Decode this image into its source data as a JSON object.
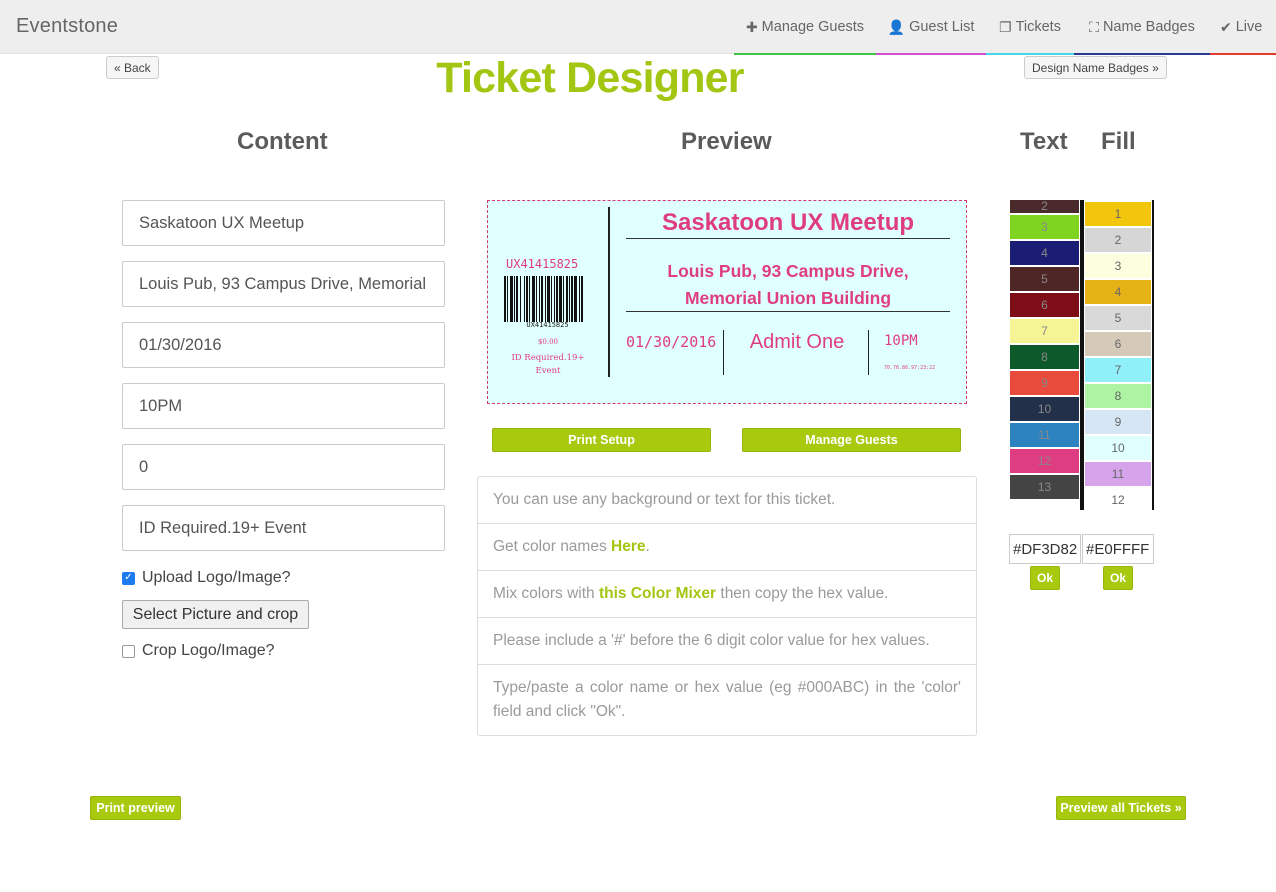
{
  "app": {
    "brand": "Eventstone"
  },
  "nav": [
    {
      "label": "Manage Guests",
      "icon": "plus-icon",
      "glyph": "✚",
      "color": "#44c344"
    },
    {
      "label": "Guest List",
      "icon": "user-icon",
      "glyph": "👤",
      "color": "#d44fcf"
    },
    {
      "label": "Tickets",
      "icon": "copy-icon",
      "glyph": "❐",
      "color": "#46d7e6"
    },
    {
      "label": "Name Badges",
      "icon": "badge-icon",
      "glyph": "⛶",
      "color": "#2a3b8f"
    },
    {
      "label": "Live",
      "icon": "check-icon",
      "glyph": "✔",
      "color": "#e23b2f"
    }
  ],
  "header": {
    "back_label": "« Back",
    "title": "Ticket Designer",
    "design_badges_label": "Design Name Badges »"
  },
  "columns": {
    "content": "Content",
    "preview": "Preview",
    "text": "Text",
    "fill": "Fill"
  },
  "fields": {
    "event_name": "Saskatoon UX Meetup",
    "venue": "Louis Pub, 93 Campus Drive, Memorial",
    "date": "01/30/2016",
    "time": "10PM",
    "price": "0",
    "notes": "ID Required.19+ Event"
  },
  "options": {
    "upload_logo_label": "Upload Logo/Image?",
    "upload_logo_checked": true,
    "select_picture_label": "Select Picture and crop",
    "crop_logo_label": "Crop Logo/Image?",
    "crop_logo_checked": false
  },
  "ticket": {
    "code": "UX41415825",
    "barcode_number": "UX41415825",
    "price": "$0.00",
    "note_line1": "ID Required.19+",
    "note_line2": "Event",
    "title": "Saskatoon UX Meetup",
    "venue_line1": "Louis Pub, 93 Campus Drive,",
    "venue_line2": "Memorial Union Building",
    "date": "01/30/2016",
    "admit": "Admit One",
    "time": "10PM",
    "ip": "70.76.86.97:23:22",
    "text_color": "#DF3D82",
    "fill_color": "#E0FFFF"
  },
  "preview_buttons": {
    "print_setup": "Print Setup",
    "manage_guests": "Manage Guests"
  },
  "info": {
    "item1": "You can use any background or text for this ticket.",
    "item2_pre": "Get color names ",
    "item2_link": "Here",
    "item2_post": ".",
    "item3_pre": "Mix colors with ",
    "item3_link": "this Color Mixer",
    "item3_post": " then copy the hex value.",
    "item4": "Please include a '#' before the 6 digit color value for hex values.",
    "item5": "Type/paste a color name or hex value (eg #000ABC) in the 'color' field and click \"Ok\"."
  },
  "text_palette": [
    {
      "n": "2",
      "c": "#4a2a2a"
    },
    {
      "n": "3",
      "c": "#7fd321"
    },
    {
      "n": "4",
      "c": "#1a1d73"
    },
    {
      "n": "5",
      "c": "#4e2626"
    },
    {
      "n": "6",
      "c": "#7d0d16"
    },
    {
      "n": "7",
      "c": "#f5f596"
    },
    {
      "n": "8",
      "c": "#0c5a2a"
    },
    {
      "n": "9",
      "c": "#e84a3c"
    },
    {
      "n": "10",
      "c": "#23304a"
    },
    {
      "n": "11",
      "c": "#2d82c0"
    },
    {
      "n": "12",
      "c": "#df3d82"
    },
    {
      "n": "13",
      "c": "#444444"
    }
  ],
  "fill_palette": [
    {
      "n": "1",
      "c": "#f2c60c"
    },
    {
      "n": "2",
      "c": "#d6d6d6"
    },
    {
      "n": "3",
      "c": "#fdfde0"
    },
    {
      "n": "4",
      "c": "#e6b316"
    },
    {
      "n": "5",
      "c": "#d9d9d9"
    },
    {
      "n": "6",
      "c": "#d5c9b8"
    },
    {
      "n": "7",
      "c": "#8ff0f9"
    },
    {
      "n": "8",
      "c": "#acf3a2"
    },
    {
      "n": "9",
      "c": "#d6e6f5"
    },
    {
      "n": "10",
      "c": "#e0ffff"
    },
    {
      "n": "11",
      "c": "#d6a4ea"
    },
    {
      "n": "12",
      "c": "#ffffff"
    }
  ],
  "hex": {
    "text": "#DF3D82",
    "fill": "#E0FFFF",
    "ok_label": "Ok"
  },
  "footer": {
    "print_preview": "Print preview",
    "preview_all": "Preview all Tickets »"
  }
}
